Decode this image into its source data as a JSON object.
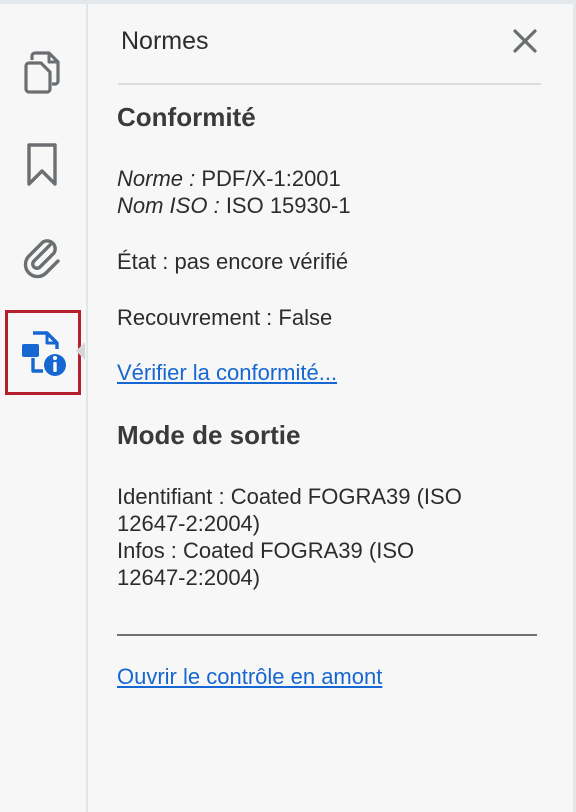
{
  "panel": {
    "title": "Normes",
    "close_label": "✕"
  },
  "sidebar": {
    "items": [
      {
        "name": "pages",
        "icon": "pages-icon"
      },
      {
        "name": "bookmarks",
        "icon": "bookmark-icon"
      },
      {
        "name": "attachments",
        "icon": "paperclip-icon"
      },
      {
        "name": "standards",
        "icon": "document-info-icon",
        "selected": true
      }
    ]
  },
  "conformance": {
    "heading": "Conformité",
    "norm_label": "Norme :",
    "norm_value": "PDF/X-1:2001",
    "iso_label": "Nom ISO :",
    "iso_value": "ISO 15930-1",
    "state": "État : pas encore vérifié",
    "overprint": "Recouvrement : False",
    "verify_link": "Vérifier la conformité..."
  },
  "output_intent": {
    "heading": "Mode de sortie",
    "identifier_line1": "Identifiant : Coated FOGRA39 (ISO",
    "identifier_line2": "12647-2:2004)",
    "info_line1": "Infos : Coated FOGRA39 (ISO",
    "info_line2": "12647-2:2004)"
  },
  "footer": {
    "preflight_link": "Ouvrir le contrôle en amont"
  },
  "colors": {
    "accent": "#1767d2",
    "selection_border": "#b5202e",
    "icon_gray": "#6b6f72"
  }
}
